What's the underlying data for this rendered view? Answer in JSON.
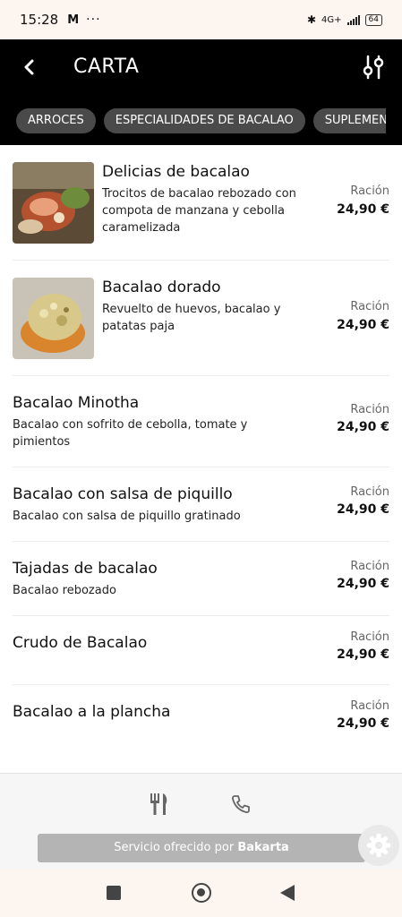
{
  "status": {
    "time": "15:28",
    "mail_icon": "M",
    "dots": "···",
    "network": "4G+",
    "battery": "64"
  },
  "header": {
    "title": "CARTA"
  },
  "categories": [
    "ARROCES",
    "ESPECIALIDADES DE BACALAO",
    "SUPLEMEN"
  ],
  "items": [
    {
      "name": "Delicias de bacalao",
      "description": "Trocitos de bacalao rebozado con compota de manzana y cebolla caramelizada",
      "unit": "Ración",
      "price": "24,90 €"
    },
    {
      "name": "Bacalao dorado",
      "description": "Revuelto de huevos, bacalao y patatas paja",
      "unit": "Ración",
      "price": "24,90 €"
    },
    {
      "name": "Bacalao Minotha",
      "description": "Bacalao con sofrito de cebolla, tomate y pimientos",
      "unit": "Ración",
      "price": "24,90 €"
    },
    {
      "name": "Bacalao con salsa de piquillo",
      "description": "Bacalao con salsa de piquillo gratinado",
      "unit": "Ración",
      "price": "24,90 €"
    },
    {
      "name": "Tajadas de bacalao",
      "description": "Bacalao rebozado",
      "unit": "Ración",
      "price": "24,90 €"
    },
    {
      "name": "Crudo de Bacalao",
      "description": "",
      "unit": "Ración",
      "price": "24,90 €"
    },
    {
      "name": "Bacalao a la plancha",
      "description": "",
      "unit": "Ración",
      "price": "24,90 €"
    }
  ],
  "footer": {
    "service_prefix": "Servicio ofrecido por",
    "service_brand": "Bakarta"
  },
  "icons": [
    "back-arrow-icon",
    "filter-sliders-icon",
    "cutlery-icon",
    "phone-icon",
    "gear-icon",
    "square-nav-icon",
    "home-circle-icon",
    "back-triangle-icon"
  ]
}
